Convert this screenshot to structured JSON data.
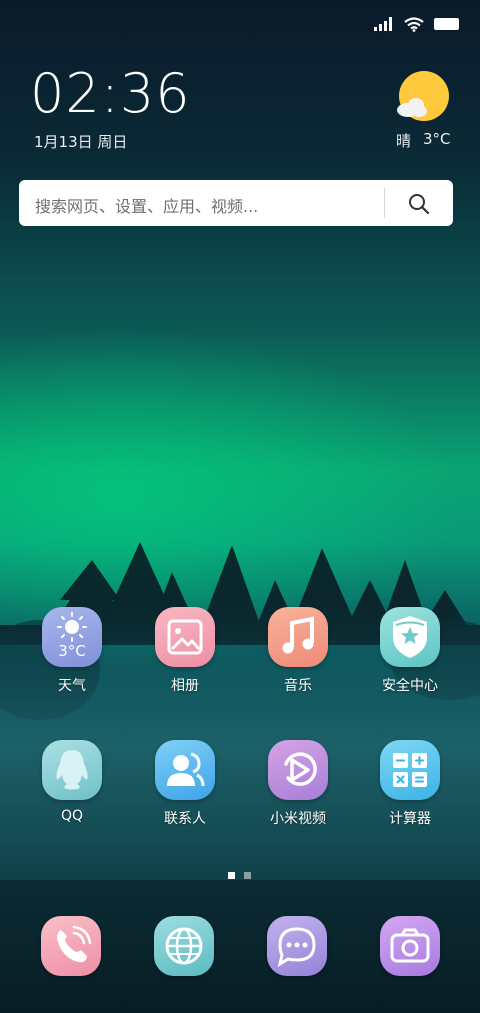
{
  "status_bar": {
    "signal_icon": "signal-icon",
    "wifi_icon": "wifi-icon",
    "battery_icon": "battery-icon"
  },
  "lockscreen": {
    "time": "02:36",
    "date": "1月13日 周日",
    "weather": {
      "condition": "晴",
      "temperature": "3°C",
      "icon": "sun-cloud-icon"
    }
  },
  "search": {
    "placeholder": "搜索网页、设置、应用、视频..."
  },
  "apps_row1": [
    {
      "label": "天气",
      "icon": "weather-app-icon",
      "icon_text": "3°C"
    },
    {
      "label": "相册",
      "icon": "gallery-app-icon"
    },
    {
      "label": "音乐",
      "icon": "music-app-icon"
    },
    {
      "label": "安全中心",
      "icon": "security-app-icon"
    }
  ],
  "apps_row2": [
    {
      "label": "QQ",
      "icon": "qq-app-icon"
    },
    {
      "label": "联系人",
      "icon": "contacts-app-icon"
    },
    {
      "label": "小米视频",
      "icon": "video-app-icon"
    },
    {
      "label": "计算器",
      "icon": "calculator-app-icon"
    }
  ],
  "page_indicator": {
    "pages": 2,
    "current": 1
  },
  "dock": [
    {
      "icon": "phone-app-icon"
    },
    {
      "icon": "browser-app-icon"
    },
    {
      "icon": "messages-app-icon"
    },
    {
      "icon": "camera-app-icon"
    }
  ],
  "colors": {
    "weather": "#8fa0de",
    "gallery": "#f49cae",
    "music": "#f4a08a",
    "security": "#7fd5d2",
    "qq": "#8fd3d8",
    "contacts": "#5cb8f0",
    "video": "#c78ee0",
    "calculator": "#58c6ee",
    "phone": "#f5a3b4",
    "browser": "#7fcfd3",
    "messages": "#b39be6",
    "camera": "#c393ec"
  }
}
